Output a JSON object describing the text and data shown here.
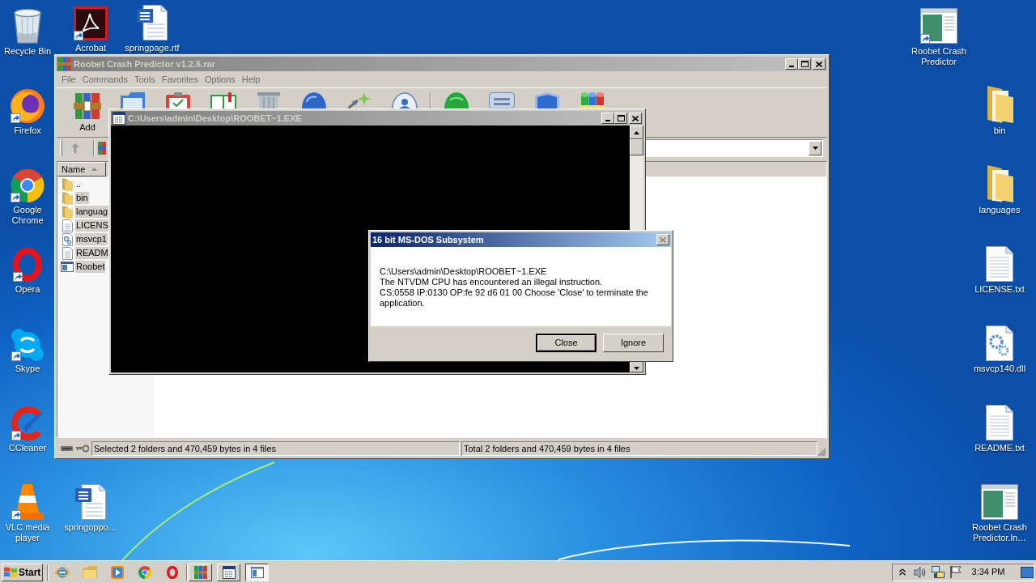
{
  "desktop": {
    "icons": [
      {
        "label": "Recycle Bin",
        "kind": "recycle",
        "shortcut": false
      },
      {
        "label": "Acrobat",
        "kind": "acrobat",
        "shortcut": true
      },
      {
        "label": "springpage.rtf",
        "kind": "document",
        "shortcut": false
      },
      {
        "label": "Firefox",
        "kind": "firefox",
        "shortcut": true
      },
      {
        "label": "Google Chrome",
        "kind": "chrome",
        "shortcut": true
      },
      {
        "label": "Opera",
        "kind": "opera",
        "shortcut": true
      },
      {
        "label": "Skype",
        "kind": "skype",
        "shortcut": true
      },
      {
        "label": "CCleaner",
        "kind": "ccleaner",
        "shortcut": true
      },
      {
        "label": "VLC media player",
        "kind": "vlc",
        "shortcut": true
      },
      {
        "label": "springoppo…",
        "kind": "document",
        "shortcut": false
      },
      {
        "label": "Roobet Crash Predictor",
        "kind": "app",
        "shortcut": true
      },
      {
        "label": "bin",
        "kind": "folder",
        "shortcut": false
      },
      {
        "label": "languages",
        "kind": "folder",
        "shortcut": false
      },
      {
        "label": "LICENSE.txt",
        "kind": "text",
        "shortcut": false
      },
      {
        "label": "msvcp140.dll",
        "kind": "dll",
        "shortcut": false
      },
      {
        "label": "README.txt",
        "kind": "text",
        "shortcut": false
      },
      {
        "label": "Roobet Crash Predictor.ln…",
        "kind": "app",
        "shortcut": false
      }
    ]
  },
  "archive_window": {
    "title": "Roobet Crash Predictor v1.2.6.rar",
    "active": false,
    "menu": [
      "File",
      "Commands",
      "Tools",
      "Favorites",
      "Options",
      "Help"
    ],
    "toolbar": [
      {
        "kind": "rar",
        "label": "Add"
      },
      {
        "kind": "folder"
      },
      {
        "kind": "clipboard"
      },
      {
        "kind": "book"
      },
      {
        "kind": "bin"
      },
      {
        "kind": "globe"
      },
      {
        "kind": "wand"
      },
      {
        "kind": "badge"
      },
      {
        "kind": "orb"
      },
      {
        "kind": "drawer"
      },
      {
        "kind": "shield"
      },
      {
        "kind": "stack"
      }
    ],
    "list_header": {
      "label": "Name",
      "sorted": true
    },
    "rows": [
      {
        "name": "..",
        "kind": "folder",
        "selected": false
      },
      {
        "name": "bin",
        "kind": "folder",
        "selected": true
      },
      {
        "name": "languag",
        "kind": "folder",
        "selected": true
      },
      {
        "name": "LICENS",
        "kind": "text",
        "selected": true
      },
      {
        "name": "msvcp1",
        "kind": "dll",
        "selected": true
      },
      {
        "name": "READM",
        "kind": "text",
        "selected": true
      },
      {
        "name": "Roobet",
        "kind": "app",
        "selected": true
      }
    ],
    "status_bar": [
      "Selected 2 folders and 470,459 bytes in 4 files",
      "Total 2 folders and 470,459 bytes in 4 files"
    ]
  },
  "console_window": {
    "title": "C:\\Users\\admin\\Desktop\\ROOBET~1.EXE",
    "active": false
  },
  "dialog": {
    "title": "16 bit MS-DOS Subsystem",
    "active": true,
    "message": "C:\\Users\\admin\\Desktop\\ROOBET~1.EXE\nThe NTVDM CPU has encountered an illegal instruction.\nCS:0558 IP:0130 OP:fe 92 d6 01 00 Choose 'Close' to terminate the application.",
    "buttons": [
      {
        "label": "Close",
        "default": true
      },
      {
        "label": "Ignore",
        "default": false
      }
    ]
  },
  "taskbar": {
    "start": "Start",
    "quick_launch": [
      {
        "kind": "ie"
      },
      {
        "kind": "explorer"
      },
      {
        "kind": "media"
      },
      {
        "kind": "chrome"
      },
      {
        "kind": "opera"
      }
    ],
    "tasks": [
      {
        "kind": "rar",
        "selected": false
      },
      {
        "kind": "console",
        "selected": false
      },
      {
        "kind": "window",
        "selected": true
      }
    ],
    "tray": [
      {
        "kind": "chevron"
      },
      {
        "kind": "speaker"
      },
      {
        "kind": "network"
      },
      {
        "kind": "flag"
      }
    ],
    "clock": "3:34 PM"
  }
}
